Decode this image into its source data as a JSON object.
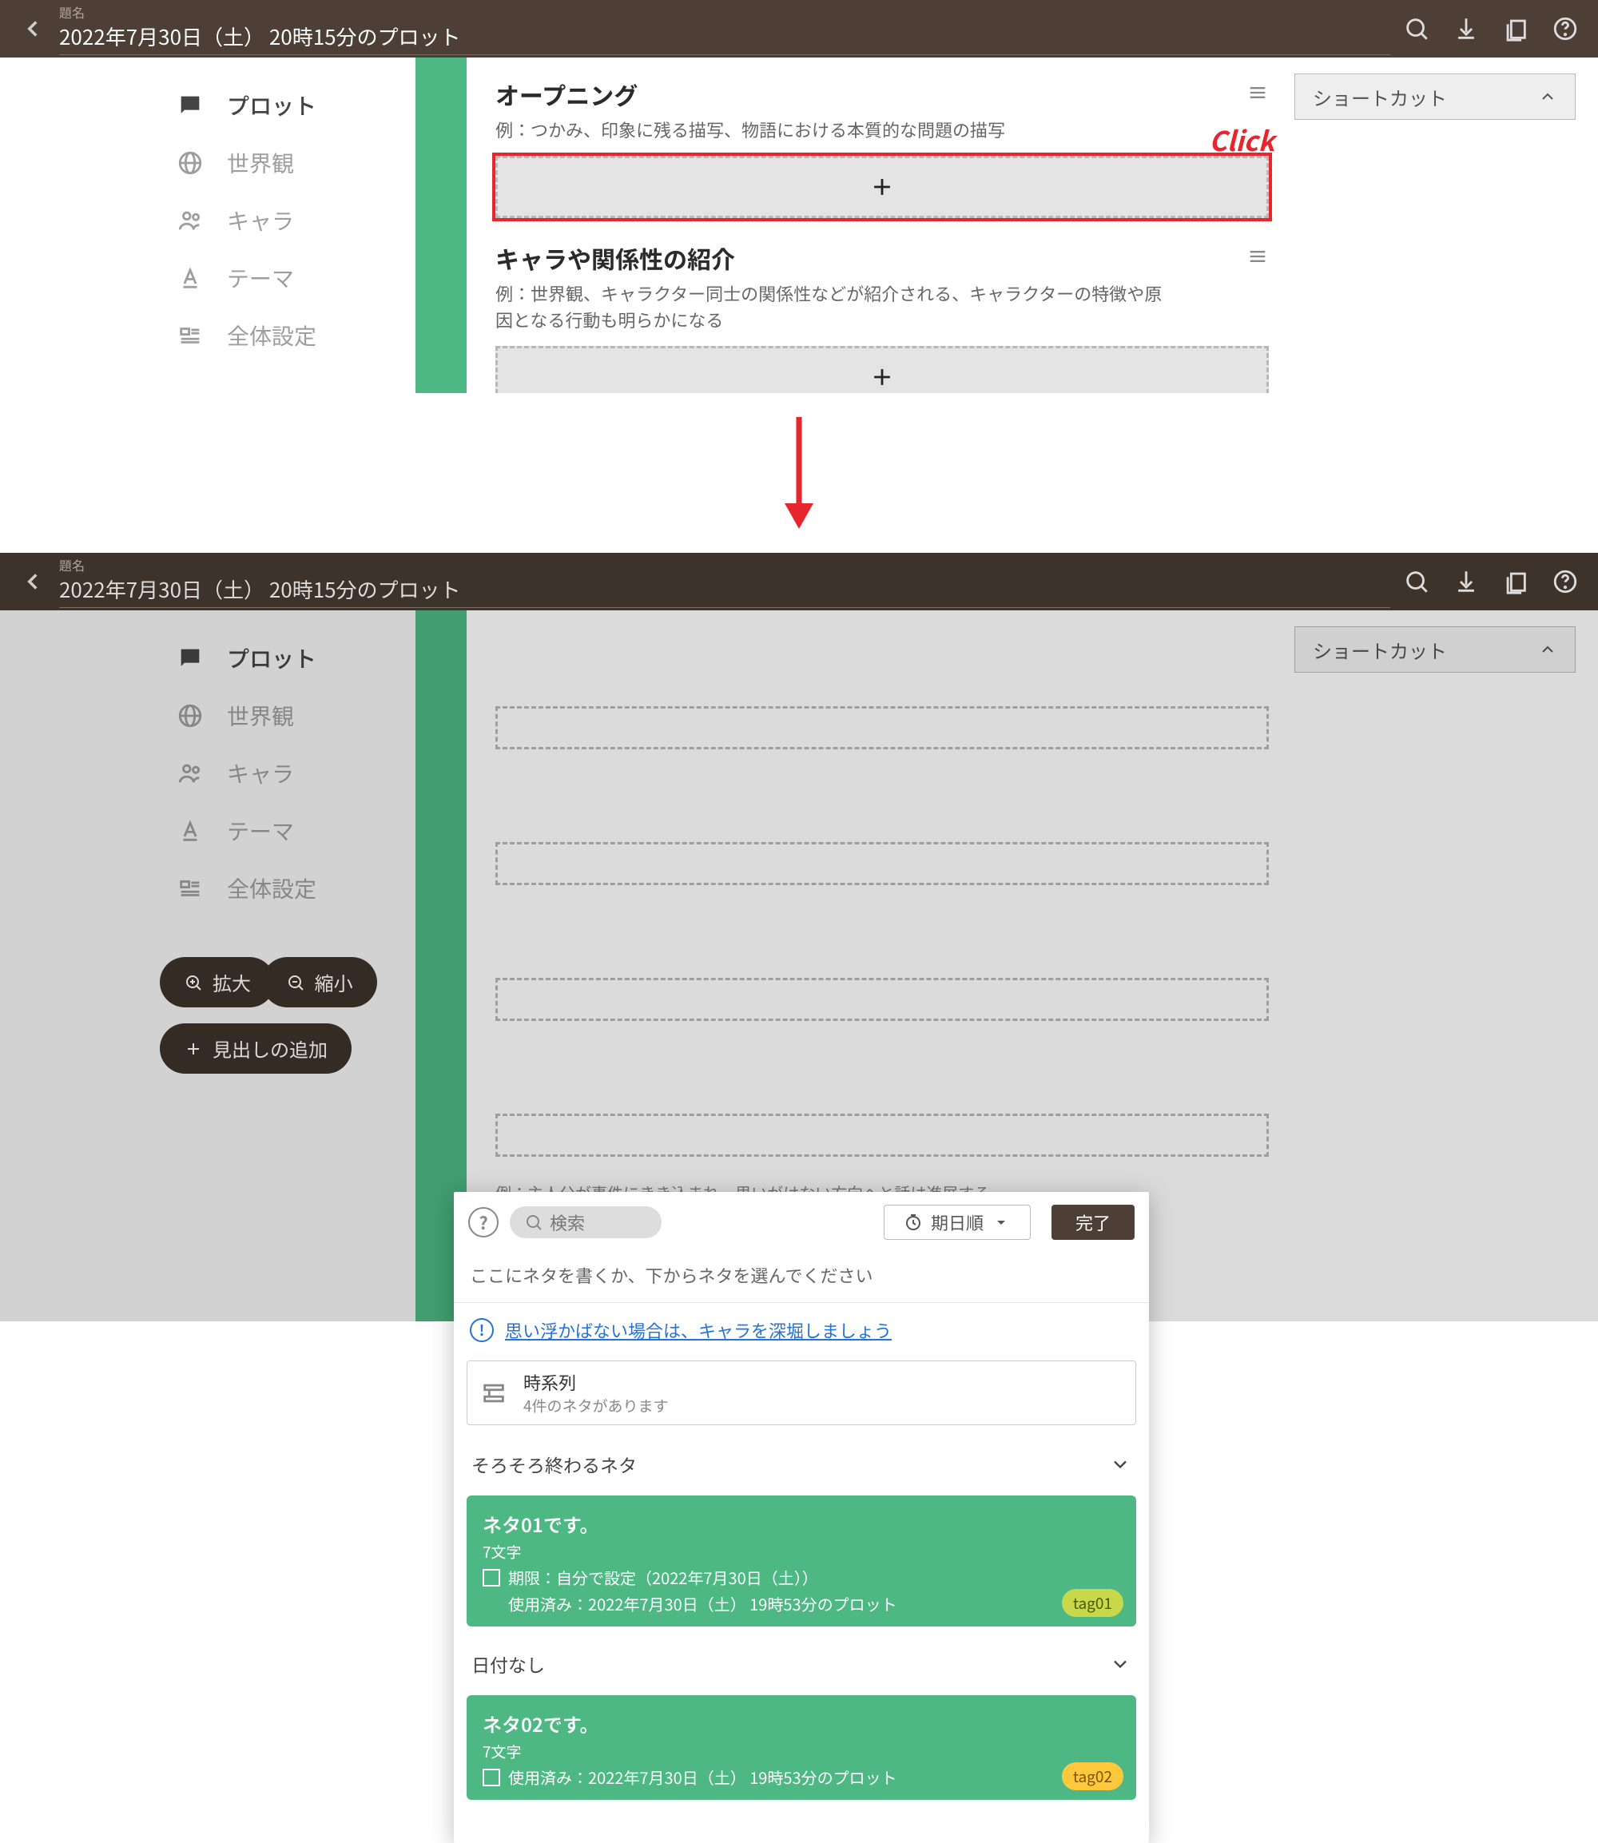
{
  "topbar": {
    "title_label": "題名",
    "title_value": "2022年7月30日（土） 20時15分のプロット"
  },
  "sidebar": {
    "items": [
      {
        "label": "プロット"
      },
      {
        "label": "世界観"
      },
      {
        "label": "キャラ"
      },
      {
        "label": "テーマ"
      },
      {
        "label": "全体設定"
      }
    ]
  },
  "shortcut_label": "ショートカット",
  "sections": [
    {
      "title": "オープニング",
      "desc": "例：つかみ、印象に残る描写、物語における本質的な問題の描写"
    },
    {
      "title": "キャラや関係性の紹介",
      "desc": "例：世界観、キャラクター同士の関係性などが紹介される、キャラクターの特徴や原因となる行動も明らかになる"
    }
  ],
  "click_label": "Click",
  "pill_buttons": {
    "zoom_in": "拡大",
    "zoom_out": "縮小",
    "add_heading": "見出しの追加"
  },
  "modal": {
    "search_placeholder": "検索",
    "sort_label": "期日順",
    "done_label": "完了",
    "hint": "ここにネタを書くか、下からネタを選んでください",
    "info_link": "思い浮かばない場合は、キャラを深堀しましょう",
    "timeline": {
      "title": "時系列",
      "subtitle": "4件のネタがあります"
    },
    "group1_title": "そろそろ終わるネタ",
    "group2_title": "日付なし",
    "card1": {
      "title": "ネタ01です。",
      "chars": "7文字",
      "deadline": "期限：自分で設定（2022年7月30日（土））",
      "used": "使用済み：2022年7月30日（土） 19時53分のプロット",
      "tag": "tag01"
    },
    "card2": {
      "title": "ネタ02です。",
      "chars": "7文字",
      "used": "使用済み：2022年7月30日（土） 19時53分のプロット",
      "tag": "tag02"
    }
  },
  "ghost_desc": "例：主人公が事件にきき込まれ、思いがけない方向へと話は進展する"
}
